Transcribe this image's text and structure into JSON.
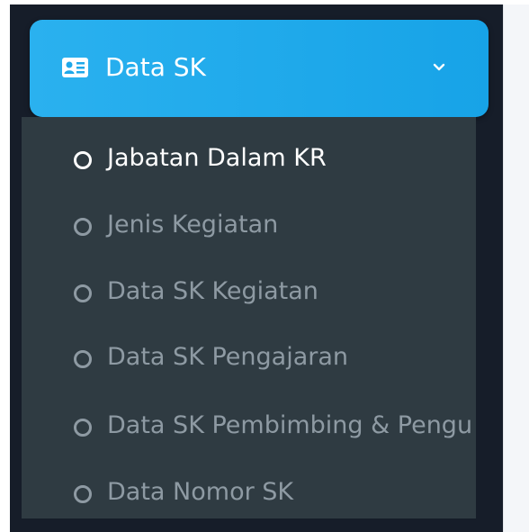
{
  "menu": {
    "header_label": "Data SK",
    "header_icon": "id-card-icon",
    "chevron_icon": "chevron-down-icon",
    "accent_color": "#1ea8ea",
    "items": [
      {
        "label": "Jabatan Dalam KR",
        "active": true
      },
      {
        "label": "Jenis Kegiatan",
        "active": false
      },
      {
        "label": "Data SK Kegiatan",
        "active": false
      },
      {
        "label": "Data SK Pengajaran",
        "active": false
      },
      {
        "label": "Data SK Pembimbing & Pengu",
        "active": false
      },
      {
        "label": "Data Nomor SK",
        "active": false
      }
    ]
  }
}
